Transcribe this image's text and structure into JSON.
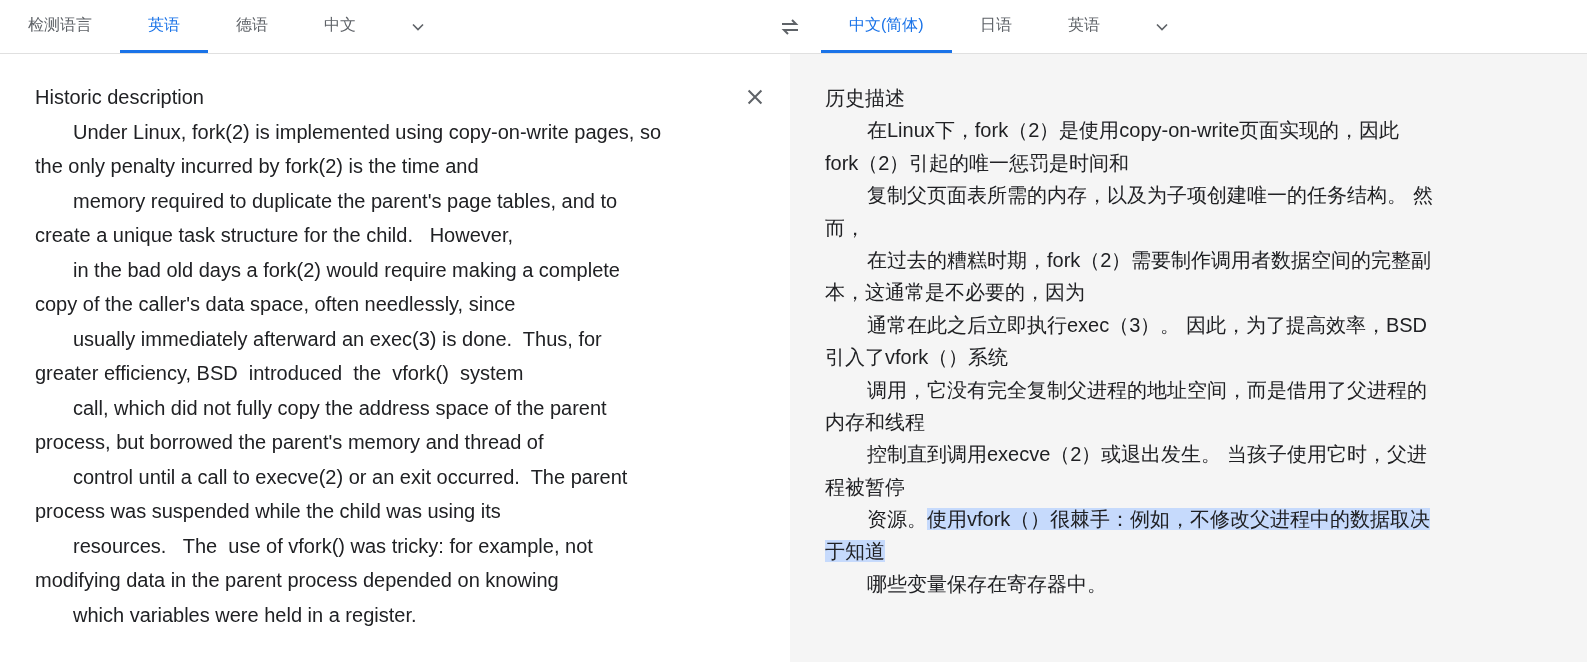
{
  "source_tabs": [
    {
      "label": "检测语言",
      "selected": false
    },
    {
      "label": "英语",
      "selected": true
    },
    {
      "label": "德语",
      "selected": false
    },
    {
      "label": "中文",
      "selected": false
    }
  ],
  "target_tabs": [
    {
      "label": "中文(简体)",
      "selected": true
    },
    {
      "label": "日语",
      "selected": false
    },
    {
      "label": "英语",
      "selected": false
    }
  ],
  "source_lines": [
    {
      "indent": false,
      "text": "Historic description"
    },
    {
      "indent": true,
      "text": "Under Linux, fork(2) is implemented using copy-on-write pages, so"
    },
    {
      "indent": false,
      "text": "the only penalty incurred by fork(2) is the time and"
    },
    {
      "indent": true,
      "text": "memory required to duplicate the parent's page tables, and to"
    },
    {
      "indent": false,
      "text": "create a unique task structure for the child.   However,"
    },
    {
      "indent": true,
      "text": "in the bad old days a fork(2) would require making a complete"
    },
    {
      "indent": false,
      "text": "copy of the caller's data space, often needlessly, since"
    },
    {
      "indent": true,
      "text": "usually immediately afterward an exec(3) is done.  Thus, for"
    },
    {
      "indent": false,
      "text": "greater efficiency, BSD  introduced  the  vfork()  system"
    },
    {
      "indent": true,
      "text": "call, which did not fully copy the address space of the parent"
    },
    {
      "indent": false,
      "text": "process, but borrowed the parent's memory and thread of"
    },
    {
      "indent": true,
      "text": "control until a call to execve(2) or an exit occurred.  The parent"
    },
    {
      "indent": false,
      "text": "process was suspended while the child was using its"
    },
    {
      "indent": true,
      "text": "resources.   The  use of vfork() was tricky: for example, not"
    },
    {
      "indent": false,
      "text": "modifying data in the parent process depended on knowing"
    },
    {
      "indent": true,
      "text": "which variables were held in a register."
    }
  ],
  "target_lines": [
    {
      "indent": false,
      "segments": [
        {
          "text": "历史描述",
          "highlighted": false
        }
      ]
    },
    {
      "indent": true,
      "segments": [
        {
          "text": "在Linux下，fork（2）是使用copy-on-write页面实现的，因此",
          "highlighted": false
        }
      ]
    },
    {
      "indent": false,
      "segments": [
        {
          "text": "fork（2）引起的唯一惩罚是时间和",
          "highlighted": false
        }
      ]
    },
    {
      "indent": true,
      "segments": [
        {
          "text": "复制父页面表所需的内存，以及为子项创建唯一的任务结构。 然",
          "highlighted": false
        }
      ]
    },
    {
      "indent": false,
      "segments": [
        {
          "text": "而，",
          "highlighted": false
        }
      ]
    },
    {
      "indent": true,
      "segments": [
        {
          "text": "在过去的糟糕时期，fork（2）需要制作调用者数据空间的完整副",
          "highlighted": false
        }
      ]
    },
    {
      "indent": false,
      "segments": [
        {
          "text": "本，这通常是不必要的，因为",
          "highlighted": false
        }
      ]
    },
    {
      "indent": true,
      "segments": [
        {
          "text": "通常在此之后立即执行exec（3）。 因此，为了提高效率，BSD",
          "highlighted": false
        }
      ]
    },
    {
      "indent": false,
      "segments": [
        {
          "text": "引入了vfork（）系统",
          "highlighted": false
        }
      ]
    },
    {
      "indent": true,
      "segments": [
        {
          "text": "调用，它没有完全复制父进程的地址空间，而是借用了父进程的",
          "highlighted": false
        }
      ]
    },
    {
      "indent": false,
      "segments": [
        {
          "text": "内存和线程",
          "highlighted": false
        }
      ]
    },
    {
      "indent": true,
      "segments": [
        {
          "text": "控制直到调用execve（2）或退出发生。 当孩子使用它时，父进",
          "highlighted": false
        }
      ]
    },
    {
      "indent": false,
      "segments": [
        {
          "text": "程被暂停",
          "highlighted": false
        }
      ]
    },
    {
      "indent": true,
      "segments": [
        {
          "text": "资源。",
          "highlighted": false
        },
        {
          "text": "使用vfork（）很棘手：例如，不修改父进程中的数据取决",
          "highlighted": true
        }
      ]
    },
    {
      "indent": false,
      "segments": [
        {
          "text": "于知道",
          "highlighted": true
        }
      ]
    },
    {
      "indent": true,
      "segments": [
        {
          "text": "哪些变量保存在寄存器中。",
          "highlighted": false
        }
      ]
    }
  ]
}
